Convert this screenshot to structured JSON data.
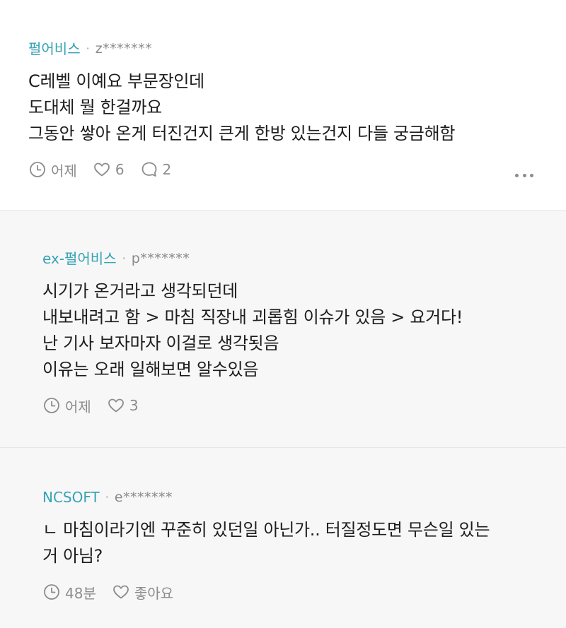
{
  "comments": [
    {
      "company": "펄어비스",
      "separator": "·",
      "nickname": "z*******",
      "lines": [
        "C레벨 이예요 부문장인데",
        "도대체 뭘 한걸까요",
        "그동안 쌓아 온게 터진건지 큰게 한방 있는건지 다들 궁금해함"
      ],
      "time": "어제",
      "likes": "6",
      "replies": "2",
      "icons": [
        "clock-icon",
        "heart-icon",
        "comment-icon",
        "more-icon"
      ]
    },
    {
      "company": "ex-펄어비스",
      "separator": "·",
      "nickname": "p*******",
      "lines": [
        "시기가 온거라고 생각되던데",
        "내보내려고 함 > 마침 직장내 괴롭힘 이슈가 있음 > 요거다!",
        "난 기사 보자마자 이걸로 생각됫음",
        "이유는 오래 일해보면 알수있음"
      ],
      "time": "어제",
      "likes": "3",
      "icons": [
        "clock-icon",
        "heart-icon"
      ]
    },
    {
      "company": "NCSOFT",
      "separator": "·",
      "nickname": "e*******",
      "lines": [
        "ㄴ 마침이라기엔 꾸준히 있던일 아닌가.. 터질정도면 무슨일 있는",
        "거 아님?"
      ],
      "time": "48분",
      "likes": "좋아요",
      "icons": [
        "clock-icon",
        "heart-icon"
      ]
    }
  ],
  "colors": {
    "company_accent": "#35a3b3",
    "meta_gray": "#8c8c8c",
    "reply_background": "#f7f7f8"
  }
}
